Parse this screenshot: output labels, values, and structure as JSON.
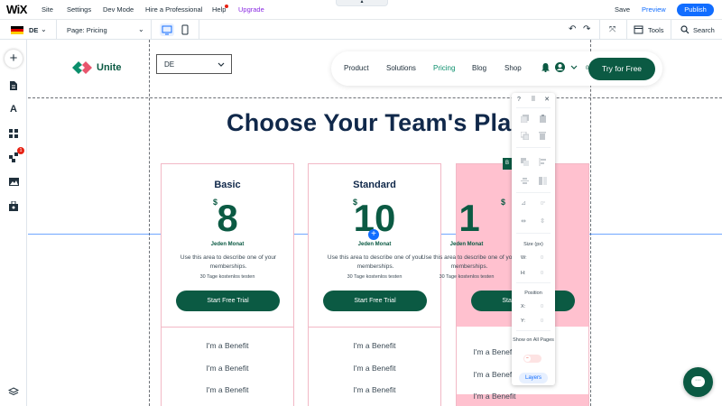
{
  "topbar": {
    "logo": "WiX",
    "menus": [
      "Site",
      "Settings",
      "Dev Mode",
      "Hire a Professional",
      "Help",
      "Upgrade"
    ],
    "save": "Save",
    "preview": "Preview",
    "publish": "Publish",
    "handle_icon": "chevron-up-icon"
  },
  "toolbar2": {
    "language": "DE",
    "page_prefix": "Page: ",
    "page": "Pricing",
    "tools": "Tools",
    "search": "Search"
  },
  "sidebar": {
    "icons": [
      "add-icon",
      "pages-icon",
      "design-icon",
      "apps-icon",
      "app-market-icon",
      "media-icon",
      "business-icon",
      "layers-icon"
    ],
    "app_badge": "1"
  },
  "site": {
    "brand": "Unite",
    "lang_select": "DE",
    "nav": [
      "Product",
      "Solutions",
      "Pricing",
      "Blog",
      "Shop"
    ],
    "active_nav": "Pricing",
    "cta": "Try for Free",
    "title": "Choose Your Team's Plan",
    "cart_count": "0",
    "hover_tag": "B"
  },
  "plans": [
    {
      "name": "Basic",
      "currency": "$",
      "price": "8",
      "period": "Jeden Monat",
      "desc": "Use this area to describe one of your memberships.",
      "trial": "30 Tage kostenlos testen",
      "button": "Start Free Trial",
      "benefits": [
        "I'm a Benefit",
        "I'm a Benefit",
        "I'm a Benefit"
      ]
    },
    {
      "name": "Standard",
      "currency": "$",
      "price": "10",
      "period": "Jeden Monat",
      "desc": "Use this area to describe one of your memberships.",
      "trial": "30 Tage kostenlos testen",
      "button": "Start Free Trial",
      "benefits": [
        "I'm a Benefit",
        "I'm a Benefit",
        "I'm a Benefit"
      ]
    },
    {
      "name": "",
      "currency": "$",
      "price": "1",
      "period": "Jeden Monat",
      "desc": "Use this area to describe one of your memberships.",
      "trial": "30 Tage kostenlos testen",
      "button": "Start Free Trial",
      "benefits": [
        "I'm a Benefit",
        "I'm a Benefit",
        "I'm a Benefit"
      ]
    }
  ],
  "inspector": {
    "help": "?",
    "size_label": "Size (px)",
    "w_label": "W:",
    "w_value": "0",
    "h_label": "H:",
    "h_value": "0",
    "angle_value": "0°",
    "position_label": "Position",
    "x_label": "X:",
    "x_value": "0",
    "y_label": "Y:",
    "y_value": "0",
    "show_on_all_pages": "Show on All Pages",
    "layers": "Layers"
  },
  "colors": {
    "accent": "#116dff",
    "brand": "#0b5a43",
    "pink": "#ffc1cf",
    "upgrade": "#8a2be2"
  }
}
